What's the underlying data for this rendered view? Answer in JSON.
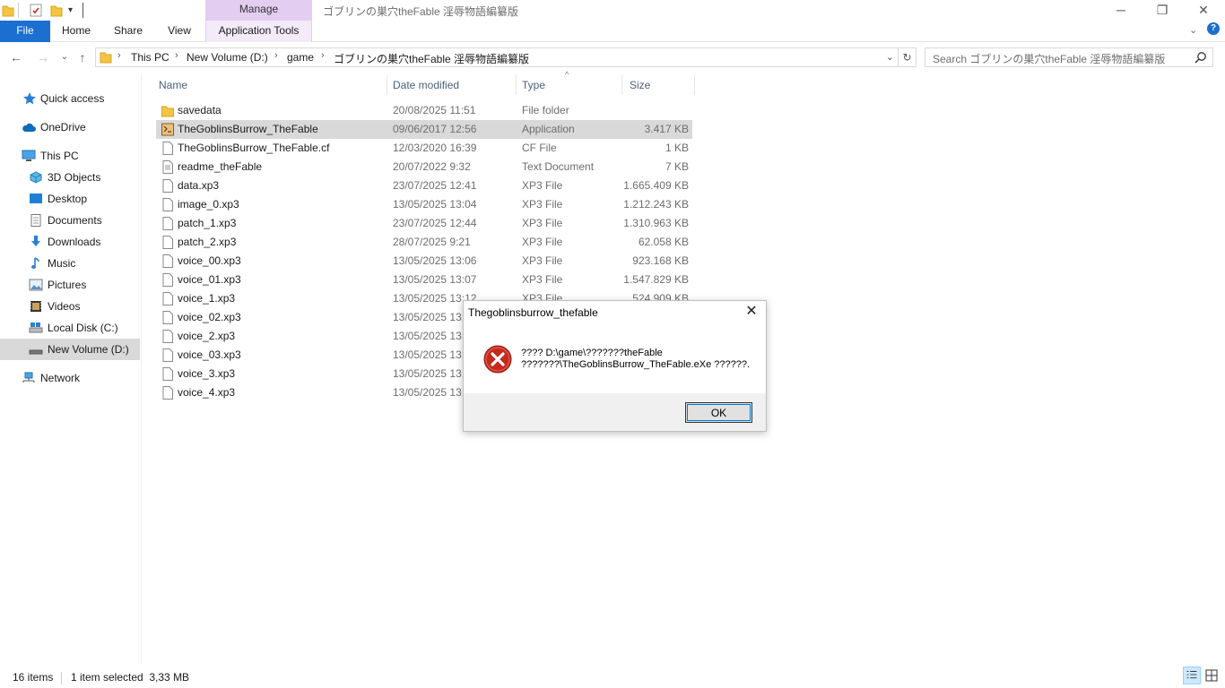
{
  "window": {
    "title": "ゴブリンの巣穴theFable 淫辱物語編纂版",
    "manage_tab": "Manage"
  },
  "ribbon": {
    "tabs": [
      "File",
      "Home",
      "Share",
      "View",
      "Application Tools"
    ]
  },
  "address": {
    "crumbs": [
      "This PC",
      "New Volume (D:)",
      "game",
      "ゴブリンの巣穴theFable 淫辱物語編纂版"
    ]
  },
  "search": {
    "placeholder": "Search ゴブリンの巣穴theFable 淫辱物語編纂版"
  },
  "sidebar": {
    "items": [
      {
        "label": "Quick access",
        "icon": "star-icon"
      },
      {
        "label": "OneDrive",
        "icon": "cloud-icon"
      },
      {
        "label": "This PC",
        "icon": "computer-icon"
      },
      {
        "label": "3D Objects",
        "icon": "cube-icon"
      },
      {
        "label": "Desktop",
        "icon": "desktop-icon"
      },
      {
        "label": "Documents",
        "icon": "document-icon"
      },
      {
        "label": "Downloads",
        "icon": "download-icon"
      },
      {
        "label": "Music",
        "icon": "music-icon"
      },
      {
        "label": "Pictures",
        "icon": "picture-icon"
      },
      {
        "label": "Videos",
        "icon": "video-icon"
      },
      {
        "label": "Local Disk (C:)",
        "icon": "drive-icon"
      },
      {
        "label": "New Volume (D:)",
        "icon": "drive-icon"
      },
      {
        "label": "Network",
        "icon": "network-icon"
      }
    ]
  },
  "columns": {
    "name": "Name",
    "date": "Date modified",
    "type": "Type",
    "size": "Size"
  },
  "files": [
    {
      "name": "savedata",
      "date": "20/08/2025 11:51",
      "type": "File folder",
      "size": "",
      "icon": "folder-icon"
    },
    {
      "name": "TheGoblinsBurrow_TheFable",
      "date": "09/06/2017 12:56",
      "type": "Application",
      "size": "3.417 KB",
      "icon": "app-icon"
    },
    {
      "name": "TheGoblinsBurrow_TheFable.cf",
      "date": "12/03/2020 16:39",
      "type": "CF File",
      "size": "1 KB",
      "icon": "file-icon"
    },
    {
      "name": "readme_theFable",
      "date": "20/07/2022 9:32",
      "type": "Text Document",
      "size": "7 KB",
      "icon": "text-file-icon"
    },
    {
      "name": "data.xp3",
      "date": "23/07/2025 12:41",
      "type": "XP3 File",
      "size": "1.665.409 KB",
      "icon": "file-icon"
    },
    {
      "name": "image_0.xp3",
      "date": "13/05/2025 13:04",
      "type": "XP3 File",
      "size": "1.212.243 KB",
      "icon": "file-icon"
    },
    {
      "name": "patch_1.xp3",
      "date": "23/07/2025 12:44",
      "type": "XP3 File",
      "size": "1.310.963 KB",
      "icon": "file-icon"
    },
    {
      "name": "patch_2.xp3",
      "date": "28/07/2025 9:21",
      "type": "XP3 File",
      "size": "62.058 KB",
      "icon": "file-icon"
    },
    {
      "name": "voice_00.xp3",
      "date": "13/05/2025 13:06",
      "type": "XP3 File",
      "size": "923.168 KB",
      "icon": "file-icon"
    },
    {
      "name": "voice_01.xp3",
      "date": "13/05/2025 13:07",
      "type": "XP3 File",
      "size": "1.547.829 KB",
      "icon": "file-icon"
    },
    {
      "name": "voice_1.xp3",
      "date": "13/05/2025 13:12",
      "type": "XP3 File",
      "size": "524.909 KB",
      "icon": "file-icon"
    },
    {
      "name": "voice_02.xp3",
      "date": "13/05/2025 13:1",
      "type": "",
      "size": "",
      "icon": "file-icon"
    },
    {
      "name": "voice_2.xp3",
      "date": "13/05/2025 13:1",
      "type": "",
      "size": "",
      "icon": "file-icon"
    },
    {
      "name": "voice_03.xp3",
      "date": "13/05/2025 13:1",
      "type": "",
      "size": "",
      "icon": "file-icon"
    },
    {
      "name": "voice_3.xp3",
      "date": "13/05/2025 13:1",
      "type": "",
      "size": "",
      "icon": "file-icon"
    },
    {
      "name": "voice_4.xp3",
      "date": "13/05/2025 13:1",
      "type": "",
      "size": "",
      "icon": "file-icon"
    }
  ],
  "status": {
    "items": "16 items",
    "selection": "1 item selected  3,33 MB"
  },
  "dialog": {
    "title": "Thegoblinsburrow_thefable",
    "message_line1": "???? D:\\game\\???????theFable",
    "message_line2": "???????\\TheGoblinsBurrow_TheFable.eXe ??????.",
    "ok": "OK"
  },
  "colors": {
    "accent": "#1a6fd0",
    "manage": "#e3cdf0",
    "selection": "#d9d9d9",
    "error": "#c42b1c"
  }
}
